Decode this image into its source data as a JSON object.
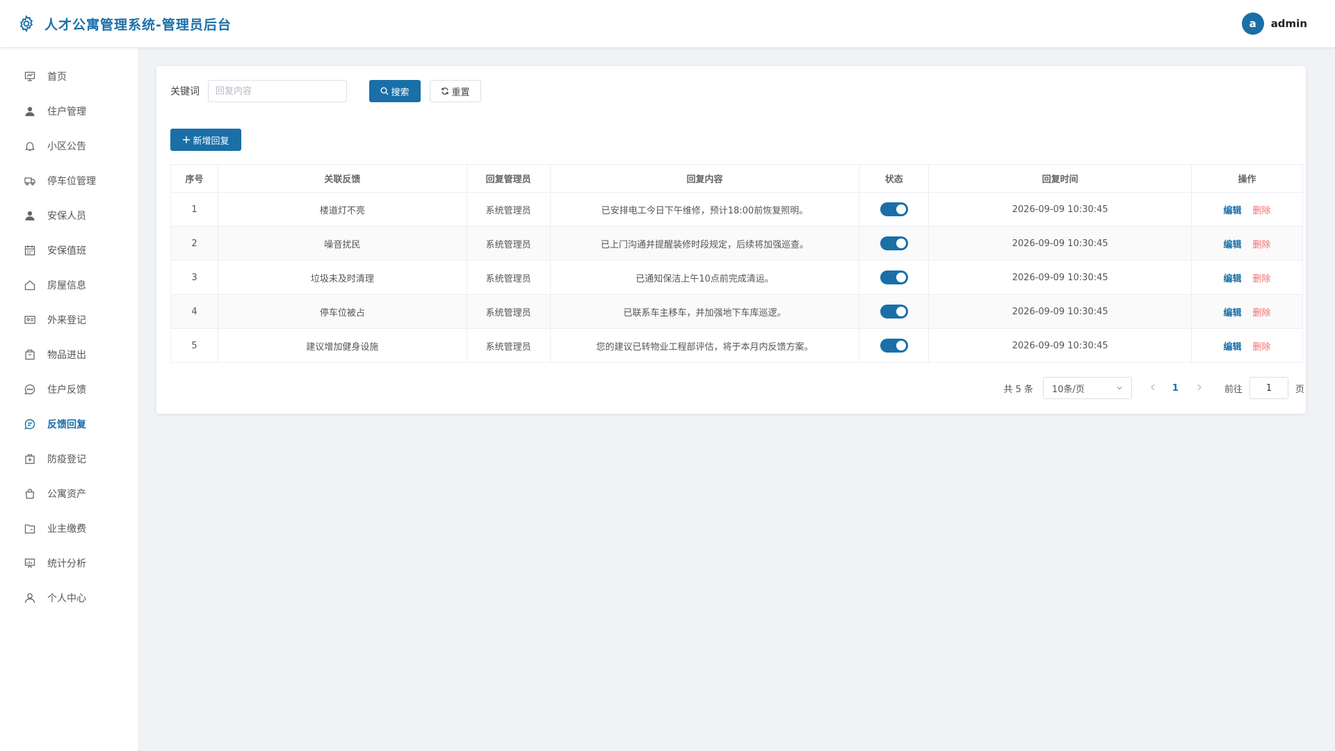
{
  "app": {
    "title": "人才公寓管理系统-管理员后台"
  },
  "user": {
    "avatar_letter": "a",
    "name": "admin"
  },
  "sidebar": {
    "items": [
      {
        "label": "首页",
        "icon": "dashboard-icon"
      },
      {
        "label": "住户管理",
        "icon": "user-icon"
      },
      {
        "label": "小区公告",
        "icon": "bell-icon"
      },
      {
        "label": "停车位管理",
        "icon": "truck-icon"
      },
      {
        "label": "安保人员",
        "icon": "user-icon"
      },
      {
        "label": "安保值班",
        "icon": "calendar-icon"
      },
      {
        "label": "房屋信息",
        "icon": "house-icon"
      },
      {
        "label": "外来登记",
        "icon": "id-card-icon"
      },
      {
        "label": "物品进出",
        "icon": "box-icon"
      },
      {
        "label": "住户反馈",
        "icon": "chat-icon"
      },
      {
        "label": "反馈回复",
        "icon": "chat-reply-icon",
        "active": true
      },
      {
        "label": "防疫登记",
        "icon": "first-aid-icon"
      },
      {
        "label": "公寓资产",
        "icon": "bag-icon"
      },
      {
        "label": "业主缴费",
        "icon": "folder-icon"
      },
      {
        "label": "统计分析",
        "icon": "chart-board-icon"
      },
      {
        "label": "个人中心",
        "icon": "user-outline-icon"
      }
    ]
  },
  "search": {
    "label": "关键词",
    "placeholder": "回复内容",
    "value": "",
    "search_button": "搜索",
    "reset_button": "重置"
  },
  "actions": {
    "add_button": "新增回复"
  },
  "table": {
    "columns": [
      "序号",
      "关联反馈",
      "回复管理员",
      "回复内容",
      "状态",
      "回复时间",
      "操作"
    ],
    "rows": [
      {
        "index": "1",
        "feedback": "楼道灯不亮",
        "admin": "系统管理员",
        "content": "已安排电工今日下午维修，预计18:00前恢复照明。",
        "status": true,
        "time": "2026-09-09 10:30:45"
      },
      {
        "index": "2",
        "feedback": "噪音扰民",
        "admin": "系统管理员",
        "content": "已上门沟通并提醒装修时段规定，后续将加强巡查。",
        "status": true,
        "time": "2026-09-09 10:30:45"
      },
      {
        "index": "3",
        "feedback": "垃圾未及时清理",
        "admin": "系统管理员",
        "content": "已通知保洁上午10点前完成清运。",
        "status": true,
        "time": "2026-09-09 10:30:45"
      },
      {
        "index": "4",
        "feedback": "停车位被占",
        "admin": "系统管理员",
        "content": "已联系车主移车，并加强地下车库巡逻。",
        "status": true,
        "time": "2026-09-09 10:30:45"
      },
      {
        "index": "5",
        "feedback": "建议增加健身设施",
        "admin": "系统管理员",
        "content": "您的建议已转物业工程部评估，将于本月内反馈方案。",
        "status": true,
        "time": "2026-09-09 10:30:45"
      }
    ],
    "edit_label": "编辑",
    "delete_label": "删除"
  },
  "pagination": {
    "total_text": "共 5 条",
    "page_size": "10条/页",
    "current_page": "1",
    "goto_label": "前往",
    "goto_value": "1",
    "page_suffix": "页"
  },
  "colors": {
    "primary": "#1a6fa8",
    "danger": "#f56c6c"
  }
}
